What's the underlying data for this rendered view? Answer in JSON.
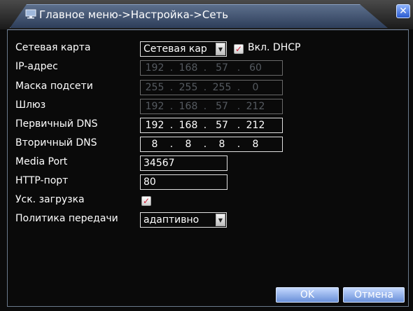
{
  "window": {
    "title": "Главное меню->Настройка->Сеть",
    "close_label": "✕"
  },
  "fields": {
    "network_card": {
      "label": "Сетевая карта",
      "value": "Сетевая кар",
      "dhcp_label": "Вкл. DHCP",
      "dhcp_checked": true
    },
    "ip_address": {
      "label": "IP-адрес",
      "octets": [
        "192",
        "168",
        "57",
        "60"
      ],
      "enabled": false
    },
    "subnet_mask": {
      "label": "Маска подсети",
      "octets": [
        "255",
        "255",
        "255",
        "0"
      ],
      "enabled": false
    },
    "gateway": {
      "label": "Шлюз",
      "octets": [
        "192",
        "168",
        "57",
        "212"
      ],
      "enabled": false
    },
    "primary_dns": {
      "label": "Первичный DNS",
      "octets": [
        "192",
        "168",
        "57",
        "212"
      ],
      "enabled": true
    },
    "secondary_dns": {
      "label": "Вторичный DNS",
      "octets": [
        "8",
        "8",
        "8",
        "8"
      ],
      "enabled": true
    },
    "media_port": {
      "label": "Media Port",
      "value": "34567"
    },
    "http_port": {
      "label": "HTTP-порт",
      "value": "80"
    },
    "fast_download": {
      "label": "Уск. загрузка",
      "checked": true
    },
    "transfer_policy": {
      "label": "Политика передачи",
      "value": "адаптивно"
    }
  },
  "buttons": {
    "ok": "OK",
    "cancel": "Отмена"
  },
  "colors": {
    "accent": "#6a90d8",
    "title_tab": "#2c3c58",
    "disabled_text": "#555a60",
    "checkmark": "#d0213a"
  }
}
